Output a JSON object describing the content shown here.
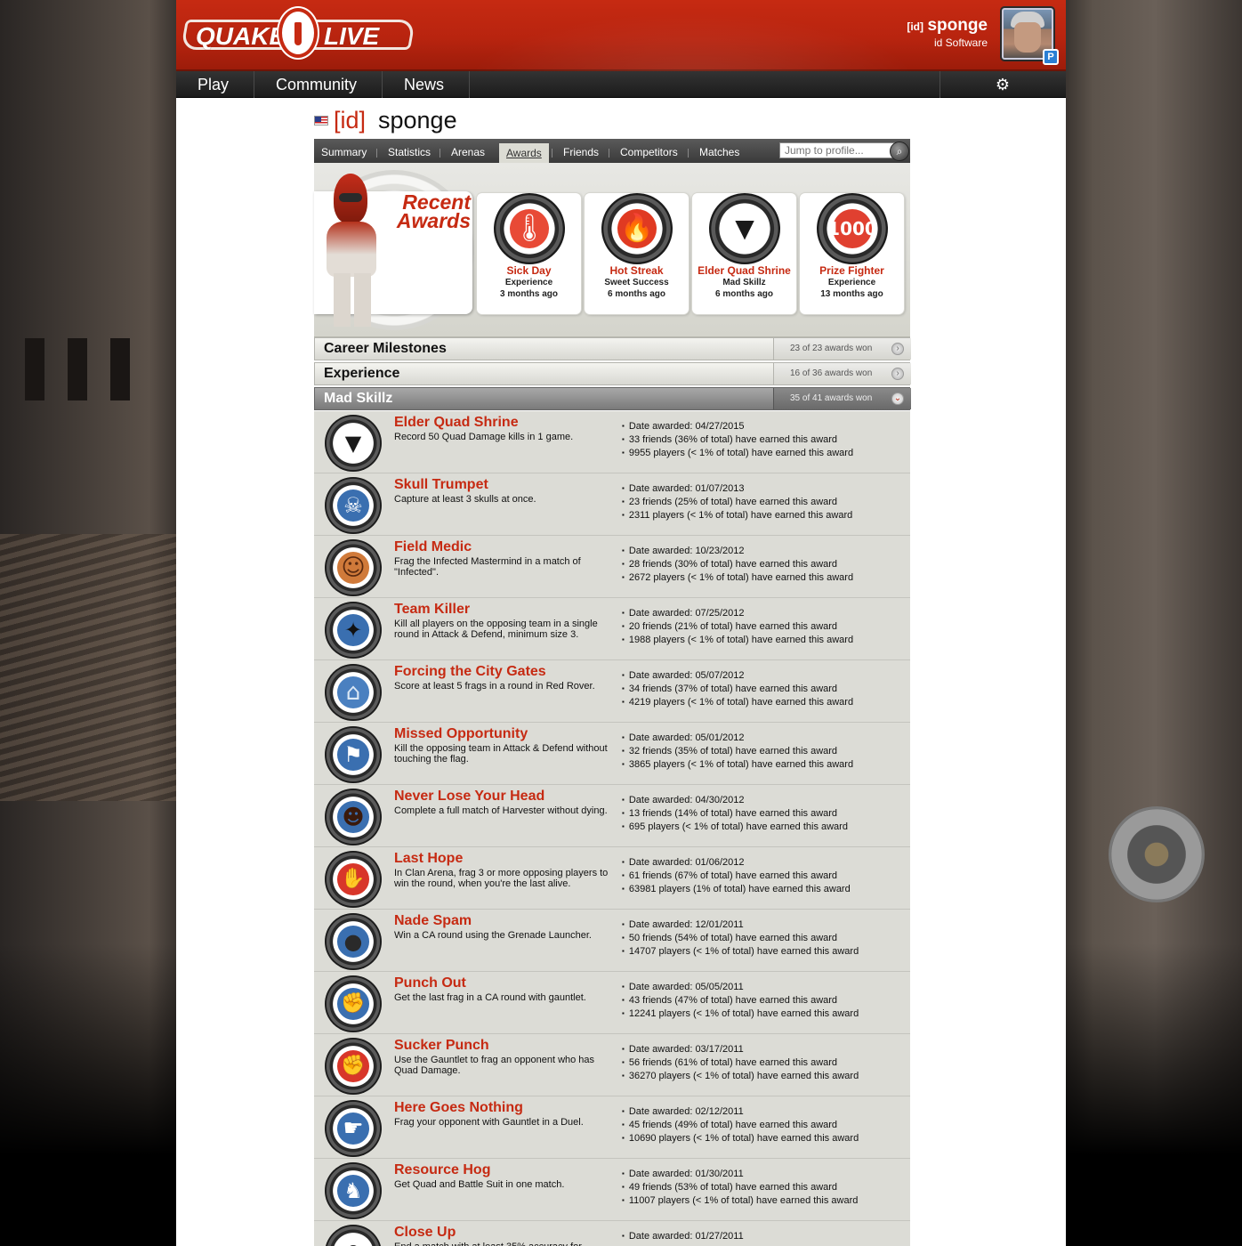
{
  "header": {
    "logo": "QUAKE LIVE",
    "user_clan": "[id]",
    "user_name": "sponge",
    "user_org": "id Software",
    "avatar_badge": "P"
  },
  "nav": {
    "items": [
      "Play",
      "Community",
      "News"
    ],
    "settings_icon": "gear-icon"
  },
  "profile": {
    "clan": "[id]",
    "name": "sponge",
    "flag": "us-flag-icon"
  },
  "tabs": {
    "items": [
      "Summary",
      "Statistics",
      "Arenas",
      "Awards",
      "Friends",
      "Competitors",
      "Matches"
    ],
    "active": "Awards",
    "jump_placeholder": "Jump to profile..."
  },
  "recent_awards": {
    "title_line1": "Recent",
    "title_line2": "Awards",
    "items": [
      {
        "name": "Sick Day",
        "category": "Experience",
        "time": "3 months ago",
        "icon": "thermometer-icon"
      },
      {
        "name": "Hot Streak",
        "category": "Sweet Success",
        "time": "6 months ago",
        "icon": "flame-icon"
      },
      {
        "name": "Elder Quad Shrine",
        "category": "Mad Skillz",
        "time": "6 months ago",
        "icon": "quad-shrine-icon"
      },
      {
        "name": "Prize Fighter",
        "category": "Experience",
        "time": "13 months ago",
        "icon": "1000-icon"
      }
    ]
  },
  "categories": [
    {
      "name": "Career Milestones",
      "count": "23 of 23 awards won",
      "open": false
    },
    {
      "name": "Experience",
      "count": "16 of 36 awards won",
      "open": false
    },
    {
      "name": "Mad Skillz",
      "count": "35 of 41 awards won",
      "open": true
    }
  ],
  "awards": [
    {
      "title": "Elder Quad Shrine",
      "desc": "Record 50 Quad Damage kills in 1 game.",
      "date": "Date awarded: 04/27/2015",
      "friends": "33 friends (36% of total) have earned this award",
      "players": "9955 players (< 1% of total) have earned this award",
      "icon": "quad-shrine-icon",
      "color": "#ffffff"
    },
    {
      "title": "Skull Trumpet",
      "desc": "Capture at least 3 skulls at once.",
      "date": "Date awarded: 01/07/2013",
      "friends": "23 friends (25% of total) have earned this award",
      "players": "2311 players (< 1% of total) have earned this award",
      "icon": "skull-icon",
      "color": "#3a6fb0"
    },
    {
      "title": "Field Medic",
      "desc": "Frag the Infected Mastermind in a match of \"Infected\".",
      "date": "Date awarded: 10/23/2012",
      "friends": "28 friends (30% of total) have earned this award",
      "players": "2672 players (< 1% of total) have earned this award",
      "icon": "medic-icon",
      "color": "#d07a3a"
    },
    {
      "title": "Team Killer",
      "desc": "Kill all players on the opposing team in a single round in Attack & Defend, minimum size 3.",
      "date": "Date awarded: 07/25/2012",
      "friends": "20 friends (21% of total) have earned this award",
      "players": "1988 players (< 1% of total) have earned this award",
      "icon": "team-killer-icon",
      "color": "#3a6fb0"
    },
    {
      "title": "Forcing the City Gates",
      "desc": "Score at least 5 frags in a round in Red Rover.",
      "date": "Date awarded: 05/07/2012",
      "friends": "34 friends (37% of total) have earned this award",
      "players": "4219 players (< 1% of total) have earned this award",
      "icon": "gate-icon",
      "color": "#4a80c0"
    },
    {
      "title": "Missed Opportunity",
      "desc": "Kill the opposing team in Attack & Defend without touching the flag.",
      "date": "Date awarded: 05/01/2012",
      "friends": "32 friends (35% of total) have earned this award",
      "players": "3865 players (< 1% of total) have earned this award",
      "icon": "flag-icon",
      "color": "#3a6fb0"
    },
    {
      "title": "Never Lose Your Head",
      "desc": "Complete a full match of Harvester without dying.",
      "date": "Date awarded: 04/30/2012",
      "friends": "13 friends (14% of total) have earned this award",
      "players": "695 players (< 1% of total) have earned this award",
      "icon": "head-icon",
      "color": "#3a6fb0"
    },
    {
      "title": "Last Hope",
      "desc": "In Clan Arena, frag 3 or more opposing players to win the round, when you're the last alive.",
      "date": "Date awarded: 01/06/2012",
      "friends": "61 friends (67% of total) have earned this award",
      "players": "63981 players (1% of total) have earned this award",
      "icon": "praying-hands-icon",
      "color": "#d8362a"
    },
    {
      "title": "Nade Spam",
      "desc": "Win a CA round using the Grenade Launcher.",
      "date": "Date awarded: 12/01/2011",
      "friends": "50 friends (54% of total) have earned this award",
      "players": "14707 players (< 1% of total) have earned this award",
      "icon": "grenade-icon",
      "color": "#3a6fb0"
    },
    {
      "title": "Punch Out",
      "desc": "Get the last frag in a CA round with gauntlet.",
      "date": "Date awarded: 05/05/2011",
      "friends": "43 friends (47% of total) have earned this award",
      "players": "12241 players (< 1% of total) have earned this award",
      "icon": "boxing-glove-icon",
      "color": "#3a6fb0"
    },
    {
      "title": "Sucker Punch",
      "desc": "Use the Gauntlet to frag an opponent who has Quad Damage.",
      "date": "Date awarded: 03/17/2011",
      "friends": "56 friends (61% of total) have earned this award",
      "players": "36270 players (< 1% of total) have earned this award",
      "icon": "fist-icon",
      "color": "#d8362a"
    },
    {
      "title": "Here Goes Nothing",
      "desc": "Frag your opponent with Gauntlet in a Duel.",
      "date": "Date awarded: 02/12/2011",
      "friends": "45 friends (49% of total) have earned this award",
      "players": "10690 players (< 1% of total) have earned this award",
      "icon": "hand-gun-icon",
      "color": "#3a6fb0"
    },
    {
      "title": "Resource Hog",
      "desc": "Get Quad and Battle Suit in one match.",
      "date": "Date awarded: 01/30/2011",
      "friends": "49 friends (53% of total) have earned this award",
      "players": "11007 players (< 1% of total) have earned this award",
      "icon": "hog-icon",
      "color": "#3a6fb0"
    },
    {
      "title": "Close Up",
      "desc": "End a match with at least 35% accuracy for",
      "date": "Date awarded: 01/27/2011",
      "friends": "",
      "players": "",
      "icon": "crosshair-icon",
      "color": "#ffffff"
    }
  ]
}
